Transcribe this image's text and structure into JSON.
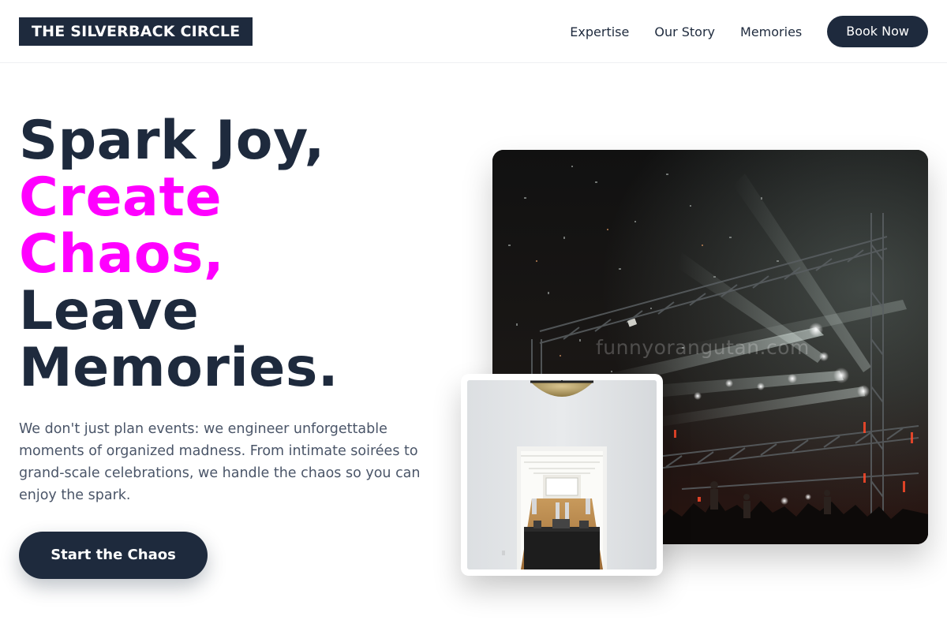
{
  "brand": {
    "name": "THE SILVERBACK CIRCLE"
  },
  "nav": {
    "links": [
      "Expertise",
      "Our Story",
      "Memories"
    ],
    "cta_label": "Book Now"
  },
  "hero": {
    "headline": {
      "line1": "Spark Joy,",
      "line2": "Create",
      "line3": "Chaos,",
      "line4": "Leave",
      "line5": "Memories."
    },
    "description": "We don't just plan events: we engineer unforgettable moments of organized madness. From intimate soirées to grand-scale celebrations, we handle the chaos so you can enjoy the spark.",
    "cta_label": "Start the Chaos"
  },
  "images": {
    "concert_watermark": "funnyorangutan.com"
  },
  "colors": {
    "primary": "#1e2a3d",
    "accent": "#ff00ff",
    "text_muted": "#4a5568"
  }
}
